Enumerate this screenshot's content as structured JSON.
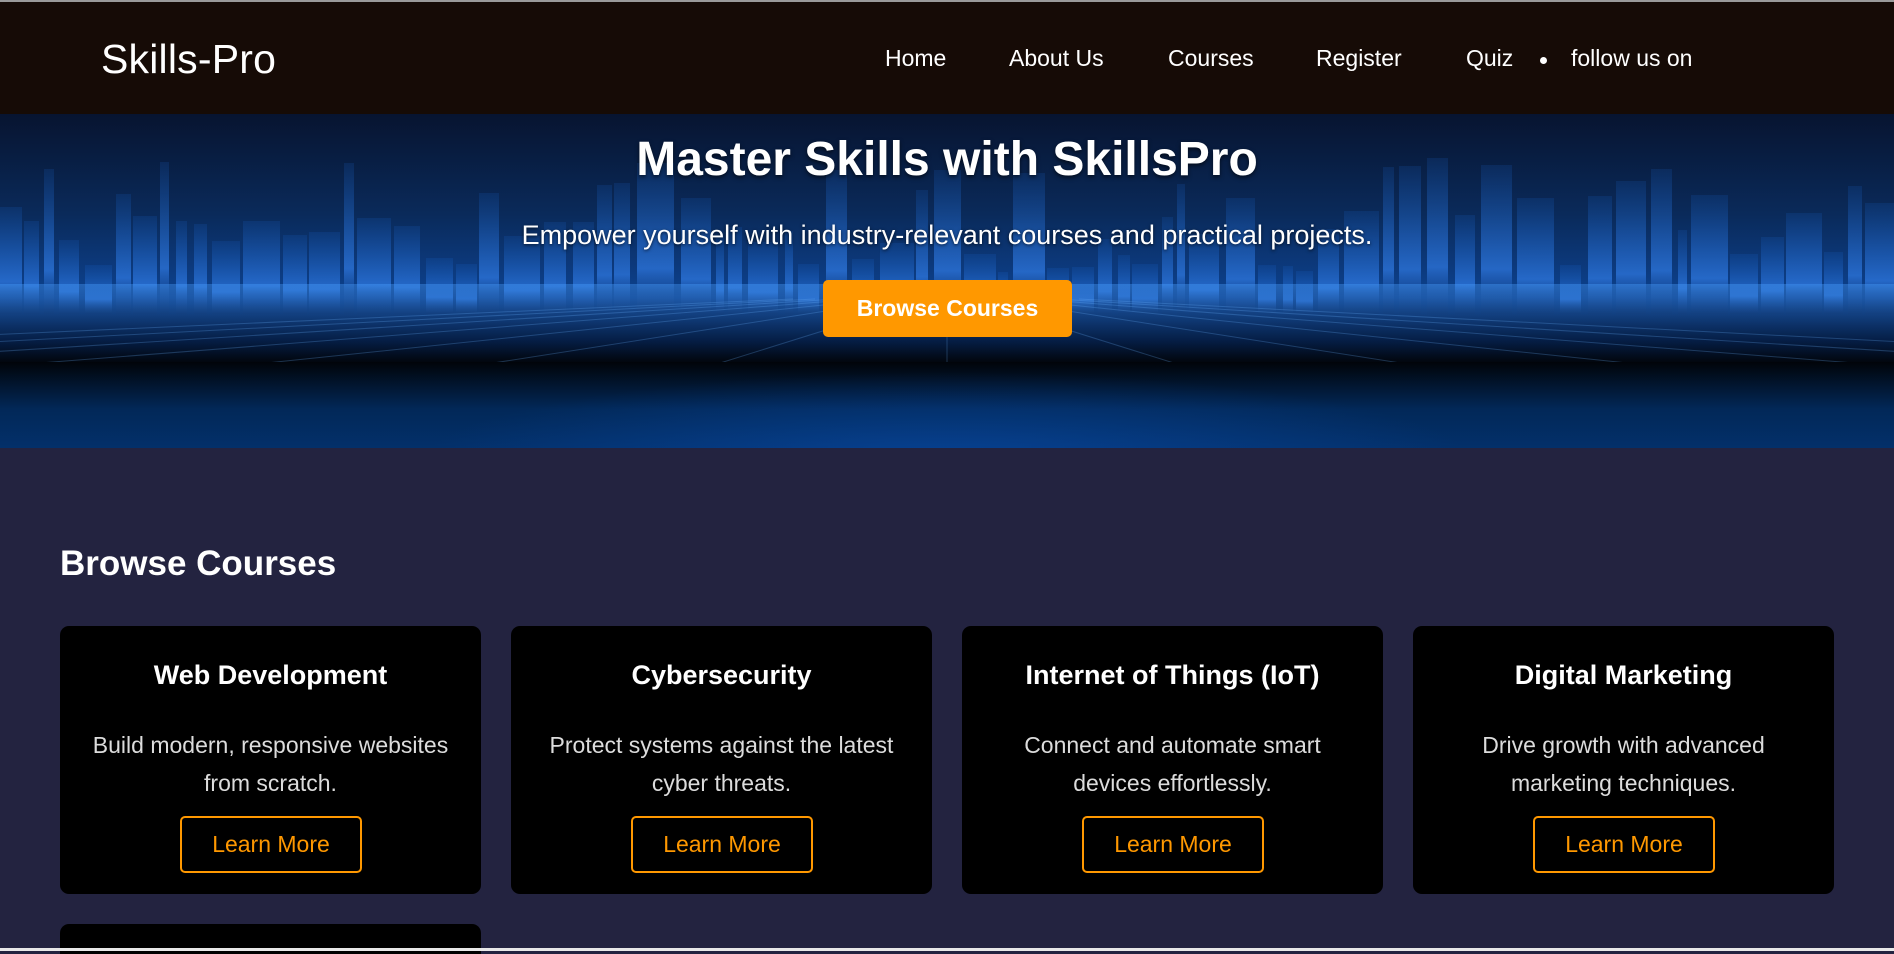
{
  "nav": {
    "brand": "Skills-Pro",
    "items": [
      {
        "label": "Home"
      },
      {
        "label": "About Us"
      },
      {
        "label": "Courses"
      },
      {
        "label": "Register"
      },
      {
        "label": "Quiz"
      },
      {
        "label": "follow us on"
      }
    ]
  },
  "hero": {
    "title": "Master Skills with SkillsPro",
    "subtitle": "Empower yourself with industry-relevant courses and practical projects.",
    "button_label": "Browse Courses"
  },
  "courses": {
    "heading": "Browse Courses",
    "cards": [
      {
        "title": "Web Development",
        "description": "Build modern, responsive websites from scratch.",
        "button": "Learn More"
      },
      {
        "title": "Cybersecurity",
        "description": "Protect systems against the latest cyber threats.",
        "button": "Learn More"
      },
      {
        "title": "Internet of Things (IoT)",
        "description": "Connect and automate smart devices effortlessly.",
        "button": "Learn More"
      },
      {
        "title": "Digital Marketing",
        "description": "Drive growth with advanced marketing techniques.",
        "button": "Learn More"
      }
    ]
  },
  "colors": {
    "nav_bg": "#160b06",
    "page_bg": "#232340",
    "accent": "#ff9800",
    "card_bg": "#000000"
  }
}
